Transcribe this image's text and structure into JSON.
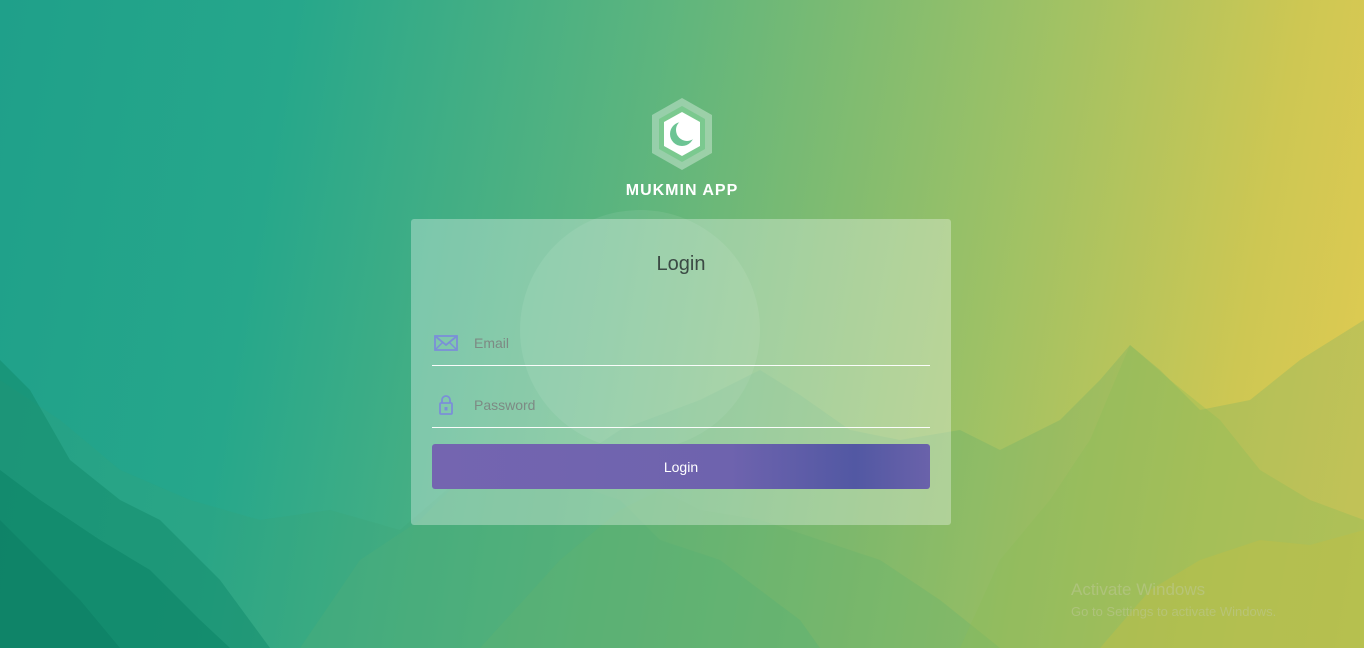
{
  "brand": {
    "app_name": "MUKMIN APP",
    "logo_icon": "crescent-moon-hexagon-logo"
  },
  "form": {
    "title": "Login",
    "email": {
      "placeholder": "Email",
      "value": "",
      "icon": "envelope-icon"
    },
    "password": {
      "placeholder": "Password",
      "value": "",
      "icon": "lock-icon"
    },
    "submit_label": "Login"
  },
  "watermark": {
    "line1": "Activate Windows",
    "line2": "Go to Settings to activate Windows."
  },
  "colors": {
    "bg_left": "#1fa08a",
    "bg_right": "#e3cb52",
    "button": "#6e63ae",
    "icon": "#7b8fd8"
  }
}
